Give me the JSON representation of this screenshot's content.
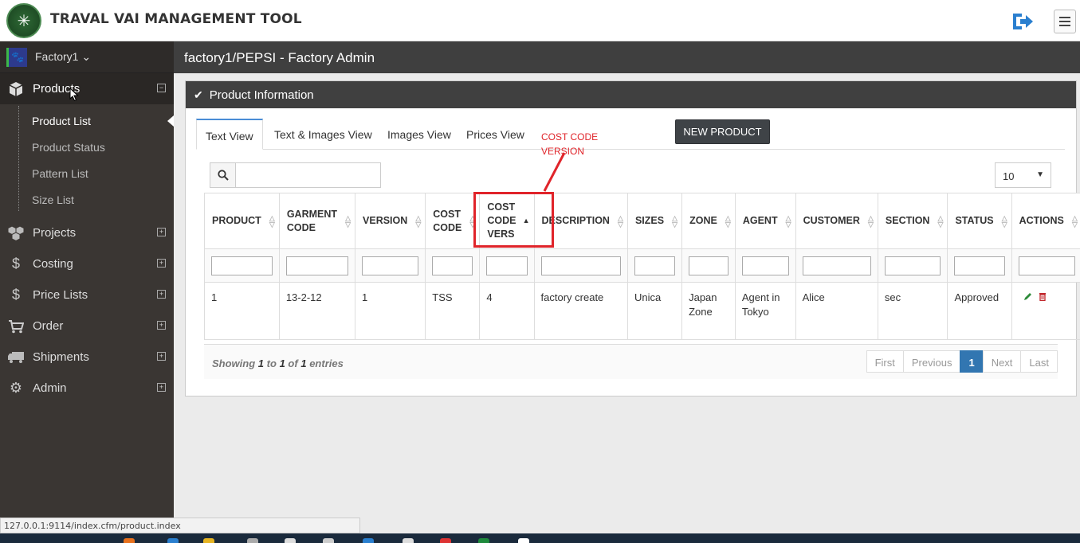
{
  "app": {
    "title": "TRAVAL VAI MANAGEMENT TOOL",
    "logo_icon": "compass-star-logo"
  },
  "sidebar": {
    "factory": "Factory1",
    "items": [
      {
        "label": "Products",
        "icon": "cube-icon",
        "expanded": true
      },
      {
        "label": "Projects",
        "icon": "cubes-icon"
      },
      {
        "label": "Costing",
        "icon": "dollar-icon"
      },
      {
        "label": "Price Lists",
        "icon": "dollar-icon"
      },
      {
        "label": "Order",
        "icon": "cart-icon"
      },
      {
        "label": "Shipments",
        "icon": "truck-icon"
      },
      {
        "label": "Admin",
        "icon": "gears-icon"
      }
    ],
    "subitems": [
      "Product List",
      "Product Status",
      "Pattern List",
      "Size List"
    ]
  },
  "header": {
    "title": "factory1/PEPSI - Factory Admin"
  },
  "panel": {
    "title": "Product Information",
    "tabs": [
      "Text View",
      "Text & Images View",
      "Images View",
      "Prices View"
    ],
    "new_button": "NEW PRODUCT",
    "annotation": [
      "COST CODE",
      "VERSION"
    ],
    "page_length": "10"
  },
  "table": {
    "columns": [
      [
        "PRODUCT"
      ],
      [
        "GARMENT",
        "CODE"
      ],
      [
        "VERSION"
      ],
      [
        "COST",
        "CODE"
      ],
      [
        "COST",
        "CODE",
        "VERS"
      ],
      [
        "DESCRIPTION"
      ],
      [
        "SIZES"
      ],
      [
        "ZONE"
      ],
      [
        "AGENT"
      ],
      [
        "CUSTOMER"
      ],
      [
        "SECTION"
      ],
      [
        "STATUS"
      ],
      [
        "ACTIONS"
      ]
    ],
    "rows": [
      [
        "1",
        "13-2-12",
        "1",
        "TSS",
        "4",
        "factory create",
        "Unica",
        "Japan Zone",
        "Agent in Tokyo",
        "Alice",
        "sec",
        "Approved"
      ]
    ]
  },
  "footer": {
    "showing": "Showing",
    "from": "1",
    "to_word": "to",
    "to": "1",
    "of_word": "of",
    "total": "1",
    "entries": "entries",
    "pager": [
      "First",
      "Previous",
      "1",
      "Next",
      "Last"
    ]
  },
  "statusbar": {
    "url": "127.0.0.1:9114/index.cfm/product.index"
  },
  "colors": {
    "accent": "#3276b1",
    "annotation": "#e0242a",
    "sidebar": "#3a3633"
  }
}
